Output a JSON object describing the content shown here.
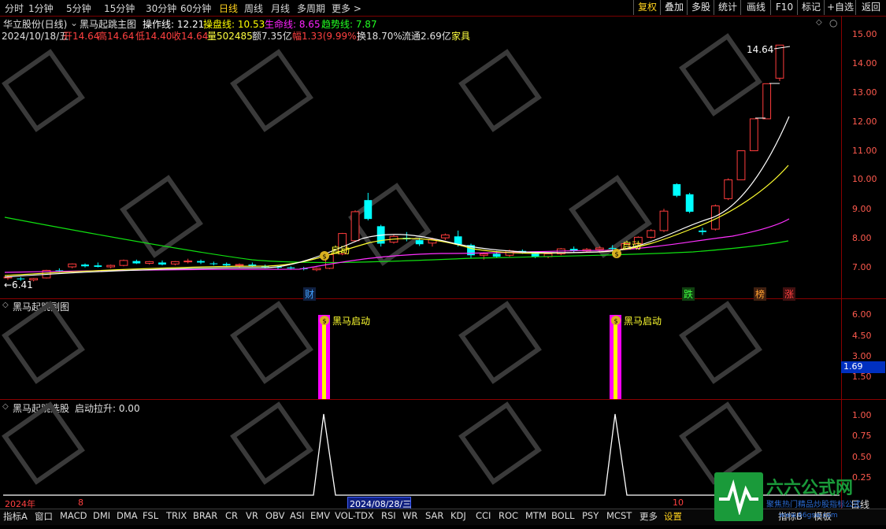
{
  "toolbar": {
    "periods": [
      "分时",
      "1分钟",
      "5分钟",
      "15分钟",
      "30分钟",
      "60分钟",
      "日线",
      "周线",
      "月线",
      "多周期",
      "更多 >"
    ],
    "active_period": "日线",
    "right_buttons": [
      "复权",
      "叠加",
      "多股",
      "统计",
      "画线",
      "F10",
      "标记",
      "+自选",
      "返回"
    ]
  },
  "main_panel": {
    "stock_name": "华立股份(日线)",
    "indicator_name": "黑马起跳主图",
    "lines": [
      {
        "label": "操作线: 12.21",
        "color": "#ffffff"
      },
      {
        "label": "操盘线: 10.53",
        "color": "#ffff00"
      },
      {
        "label": "生命线: 8.65",
        "color": "#ff00ff"
      },
      {
        "label": "趋势线: 7.87",
        "color": "#00ff00"
      }
    ],
    "date": "2024/10/18/五",
    "open_label": "开14.64",
    "high_label": "高14.64",
    "low_label": "低14.40",
    "close_label": "收14.64",
    "volume_label": "量502485",
    "amount_label": "额7.35亿",
    "change_label": "幅1.33(9.99%)",
    "turnover_label": "换18.70%",
    "float_label": "流通2.69亿",
    "sector": "家具",
    "high_marker": "14.64",
    "low_marker": "←6.41",
    "signal_label": "启动",
    "badges": [
      "财",
      "跌",
      "榜",
      "涨"
    ],
    "y_ticks": [
      "15.00",
      "14.00",
      "13.00",
      "12.00",
      "11.00",
      "10.00",
      "9.00",
      "8.00",
      "7.00"
    ],
    "colors": {
      "up": "#ff3c3c",
      "down": "#00ffff",
      "grid": "#8a0000"
    }
  },
  "sub_panel": {
    "title": "黑马起跳副图",
    "signal_label": "黑马启动",
    "y_ticks": [
      "6.00",
      "4.50",
      "3.00",
      "1.50"
    ],
    "current_value": "1.69"
  },
  "select_panel": {
    "title": "黑马起跳选股",
    "param": "启动拉升: 0.00",
    "y_ticks": [
      "1.00",
      "0.75",
      "0.50",
      "0.25"
    ]
  },
  "time_axis": {
    "year": "2024年",
    "month1": "8",
    "cursor_date": "2024/08/28/三",
    "month2": "10"
  },
  "index_bar": {
    "items": [
      "指标A",
      "窗口",
      "MACD",
      "DMI",
      "DMA",
      "FSL",
      "TRIX",
      "BRAR",
      "CR",
      "VR",
      "OBV",
      "ASI",
      "EMV",
      "VOL-TDX",
      "RSI",
      "WR",
      "SAR",
      "KDJ",
      "CCI",
      "ROC",
      "MTM",
      "BOLL",
      "PSY",
      "MCST",
      "更多",
      "设置"
    ],
    "active": "设置",
    "right_items": [
      "指标B",
      "模板"
    ]
  },
  "corner": {
    "daily_label": "日线"
  },
  "logo": {
    "text": "六六公式网",
    "slogan": "聚焦热门精品炒股指标公式",
    "url": "www.66gsw.com"
  },
  "chart_data": {
    "type": "candlestick",
    "ylim": [
      6.2,
      15.4
    ],
    "candles": [
      [
        6.62,
        6.7,
        6.55,
        6.65
      ],
      [
        6.6,
        6.65,
        6.52,
        6.58
      ],
      [
        6.55,
        6.62,
        6.5,
        6.6
      ],
      [
        6.62,
        6.9,
        6.6,
        6.88
      ],
      [
        6.88,
        6.95,
        6.8,
        6.84
      ],
      [
        7.0,
        7.12,
        6.95,
        7.1
      ],
      [
        7.08,
        7.12,
        6.98,
        7.02
      ],
      [
        7.05,
        7.15,
        6.98,
        7.0
      ],
      [
        7.0,
        7.08,
        6.95,
        7.05
      ],
      [
        7.05,
        7.25,
        7.02,
        7.22
      ],
      [
        7.2,
        7.25,
        7.1,
        7.12
      ],
      [
        7.12,
        7.2,
        7.08,
        7.18
      ],
      [
        7.15,
        7.22,
        7.05,
        7.08
      ],
      [
        7.1,
        7.2,
        7.05,
        7.18
      ],
      [
        7.18,
        7.28,
        7.12,
        7.2
      ],
      [
        7.2,
        7.25,
        7.1,
        7.15
      ],
      [
        7.12,
        7.18,
        7.05,
        7.1
      ],
      [
        7.1,
        7.15,
        7.0,
        7.05
      ],
      [
        7.05,
        7.12,
        6.98,
        7.08
      ],
      [
        7.08,
        7.15,
        7.0,
        7.02
      ],
      [
        7.02,
        7.08,
        6.95,
        7.0
      ],
      [
        7.0,
        7.05,
        6.92,
        6.98
      ],
      [
        6.98,
        7.02,
        6.9,
        6.95
      ],
      [
        6.95,
        7.0,
        6.88,
        6.92
      ],
      [
        6.9,
        6.98,
        6.85,
        6.95
      ],
      [
        6.95,
        7.45,
        6.92,
        7.42
      ],
      [
        7.45,
        8.17,
        7.4,
        8.15
      ],
      [
        7.9,
        8.95,
        7.85,
        8.9
      ],
      [
        9.3,
        9.55,
        8.6,
        8.65
      ],
      [
        8.4,
        8.45,
        7.7,
        7.8
      ],
      [
        7.85,
        8.1,
        7.8,
        8.05
      ],
      [
        8.0,
        8.2,
        7.88,
        7.95
      ],
      [
        7.92,
        8.0,
        7.72,
        7.78
      ],
      [
        7.82,
        8.0,
        7.7,
        7.95
      ],
      [
        8.0,
        8.15,
        7.92,
        8.1
      ],
      [
        8.05,
        8.25,
        7.7,
        7.78
      ],
      [
        7.75,
        7.8,
        7.3,
        7.4
      ],
      [
        7.4,
        7.5,
        7.25,
        7.45
      ],
      [
        7.45,
        7.55,
        7.32,
        7.35
      ],
      [
        7.4,
        7.6,
        7.35,
        7.55
      ],
      [
        7.55,
        7.6,
        7.45,
        7.48
      ],
      [
        7.48,
        7.52,
        7.3,
        7.35
      ],
      [
        7.35,
        7.48,
        7.3,
        7.45
      ],
      [
        7.45,
        7.65,
        7.4,
        7.62
      ],
      [
        7.62,
        7.7,
        7.5,
        7.55
      ],
      [
        7.55,
        7.65,
        7.5,
        7.6
      ],
      [
        7.6,
        7.7,
        7.5,
        7.65
      ],
      [
        7.65,
        7.75,
        7.55,
        7.62
      ],
      [
        7.62,
        7.85,
        7.6,
        7.8
      ],
      [
        7.8,
        8.05,
        7.75,
        8.02
      ],
      [
        8.02,
        8.3,
        7.98,
        8.25
      ],
      [
        8.25,
        9.0,
        8.2,
        8.92
      ],
      [
        9.85,
        9.88,
        9.4,
        9.45
      ],
      [
        9.5,
        9.55,
        8.85,
        8.9
      ],
      [
        8.25,
        8.35,
        8.1,
        8.2
      ],
      [
        8.3,
        9.15,
        8.25,
        9.1
      ],
      [
        9.35,
        10.05,
        9.3,
        10.0
      ],
      [
        10.0,
        11.0,
        10.0,
        11.0
      ],
      [
        11.0,
        12.1,
        11.0,
        12.1
      ],
      [
        12.1,
        13.31,
        12.1,
        13.31
      ],
      [
        13.5,
        14.64,
        13.4,
        14.64
      ]
    ]
  }
}
